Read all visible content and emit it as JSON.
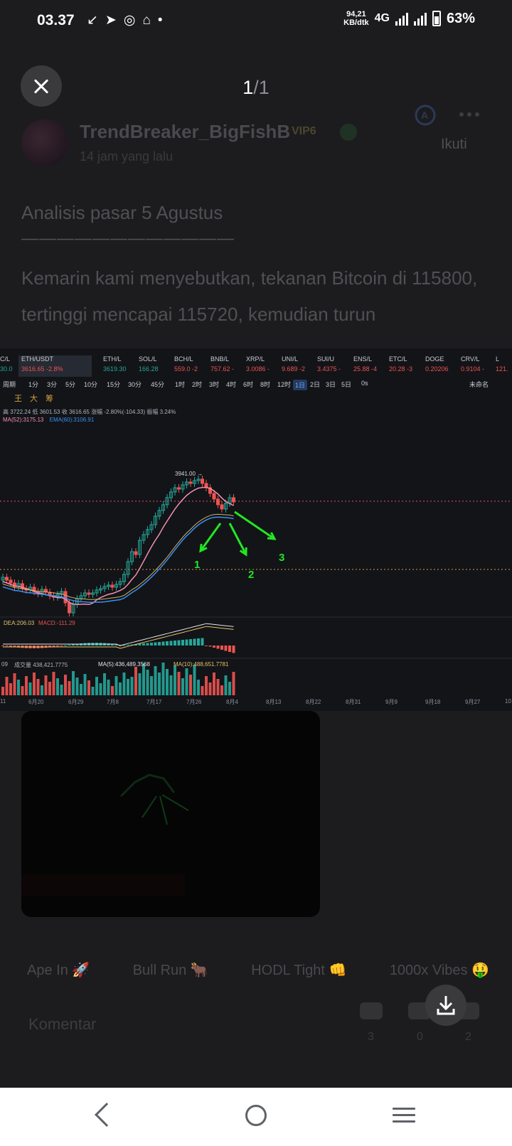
{
  "status_bar": {
    "time": "03.37",
    "notification_icons": [
      "missed-call-icon",
      "telegram-icon",
      "whatsapp-icon",
      "discord-icon",
      "dot-icon"
    ],
    "speed_value": "94,21",
    "speed_unit": "KB/dtk",
    "network": "4G",
    "battery": "63%"
  },
  "viewer": {
    "current": "1",
    "total": "/1"
  },
  "post": {
    "author": "TrendBreaker_BigFishB",
    "badge": "VIP6",
    "time_ago": "14 jam yang lalu",
    "follow_label": "Ikuti",
    "title": "Analisis pasar 5 Agustus",
    "divider": "————————————",
    "body": "Kemarin kami menyebutkan, tekanan Bitcoin di 115800, tertinggi mencapai 115720, kemudian turun",
    "tags": [
      "Ape In 🚀",
      "Bull Run 🐂",
      "HODL Tight 👊",
      "1000x Vibes 🤑"
    ],
    "comment_label": "Komentar",
    "stats": [
      "3",
      "0",
      "2"
    ]
  },
  "chart": {
    "tickers": [
      {
        "name": "C/L",
        "price": "30.0"
      },
      {
        "name": "ETH/USDT",
        "price": "3616.65",
        "change": "-2.8%"
      },
      {
        "name": "ETH/L",
        "price": "3619.30",
        "change": ""
      },
      {
        "name": "SOL/L",
        "price": "166.28",
        "change": ""
      },
      {
        "name": "BCH/L",
        "price": "559.0",
        "change": "-2"
      },
      {
        "name": "BNB/L",
        "price": "757.62",
        "change": "-"
      },
      {
        "name": "XRP/L",
        "price": "3.0086",
        "change": "-"
      },
      {
        "name": "UNI/L",
        "price": "9.689",
        "change": "-2"
      },
      {
        "name": "SUI/U",
        "price": "3.4375",
        "change": "-"
      },
      {
        "name": "ENS/L",
        "price": "25.88",
        "change": "-4"
      },
      {
        "name": "ETC/L",
        "price": "20.28",
        "change": "-3"
      },
      {
        "name": "DOGE",
        "price": "0.20206",
        "change": ""
      },
      {
        "name": "CRV/L",
        "price": "0.9104",
        "change": "-"
      },
      {
        "name": "L",
        "price": "121.",
        "change": ""
      }
    ],
    "timeframes": [
      "周期",
      "1分",
      "3分",
      "5分",
      "10分",
      "15分",
      "30分",
      "45分",
      "1时",
      "2时",
      "3时",
      "4时",
      "6时",
      "8时",
      "12时",
      "1日",
      "2日",
      "3日",
      "5日",
      "0s"
    ],
    "selected_timeframe": "1日",
    "unnamed_label": "未命名",
    "tool_glyphs": [
      "王",
      "大",
      "筹"
    ],
    "ohlc_text": "高 3722.24  低 3601.53  收 3616.65  涨幅 -2.80%(-104.33)  振幅 3.24%",
    "ma_text": "MA(52):3175.13",
    "ema_text": "EMA(60):3106.91",
    "high_label": "3941.00 →",
    "macd_dea": "DEA:206.03",
    "macd_value": "MACD:-111.29",
    "vol_text": "09",
    "vol_text2": "成交量 438,421.7775",
    "vol_ma5": "MA(5):436,489.3568",
    "vol_ma10": "MA(10):488,651.7781",
    "dates": [
      "11",
      "6月20",
      "6月29",
      "7月8",
      "7月17",
      "7月26",
      "8月4",
      "8月13",
      "8月22",
      "8月31",
      "9月9",
      "9月18",
      "9月27",
      "10"
    ],
    "arrow_labels": [
      "1",
      "2",
      "3"
    ],
    "colors": {
      "up": "#26a69a",
      "down": "#ef5350",
      "arrow": "#22e622",
      "ma": "#f48fb1",
      "ema": "#3d8ef0"
    }
  },
  "chart_data": {
    "type": "candlestick",
    "title": "ETH/USDT",
    "interval": "1日",
    "x": [
      "6月20",
      "6月29",
      "7月8",
      "7月17",
      "7月26",
      "8月4"
    ],
    "last": {
      "high": 3722.24,
      "low": 3601.53,
      "close": 3616.65,
      "change_pct": -2.8,
      "change": -104.33,
      "amplitude_pct": 3.24
    },
    "indicators": {
      "MA52": 3175.13,
      "EMA60": 3106.91,
      "DEA": 206.03,
      "MACD": -111.29
    },
    "marked_high": 3941.0,
    "volume": {
      "last": 438421.7775,
      "MA5": 436489.3568,
      "MA10": 488651.7781
    }
  }
}
